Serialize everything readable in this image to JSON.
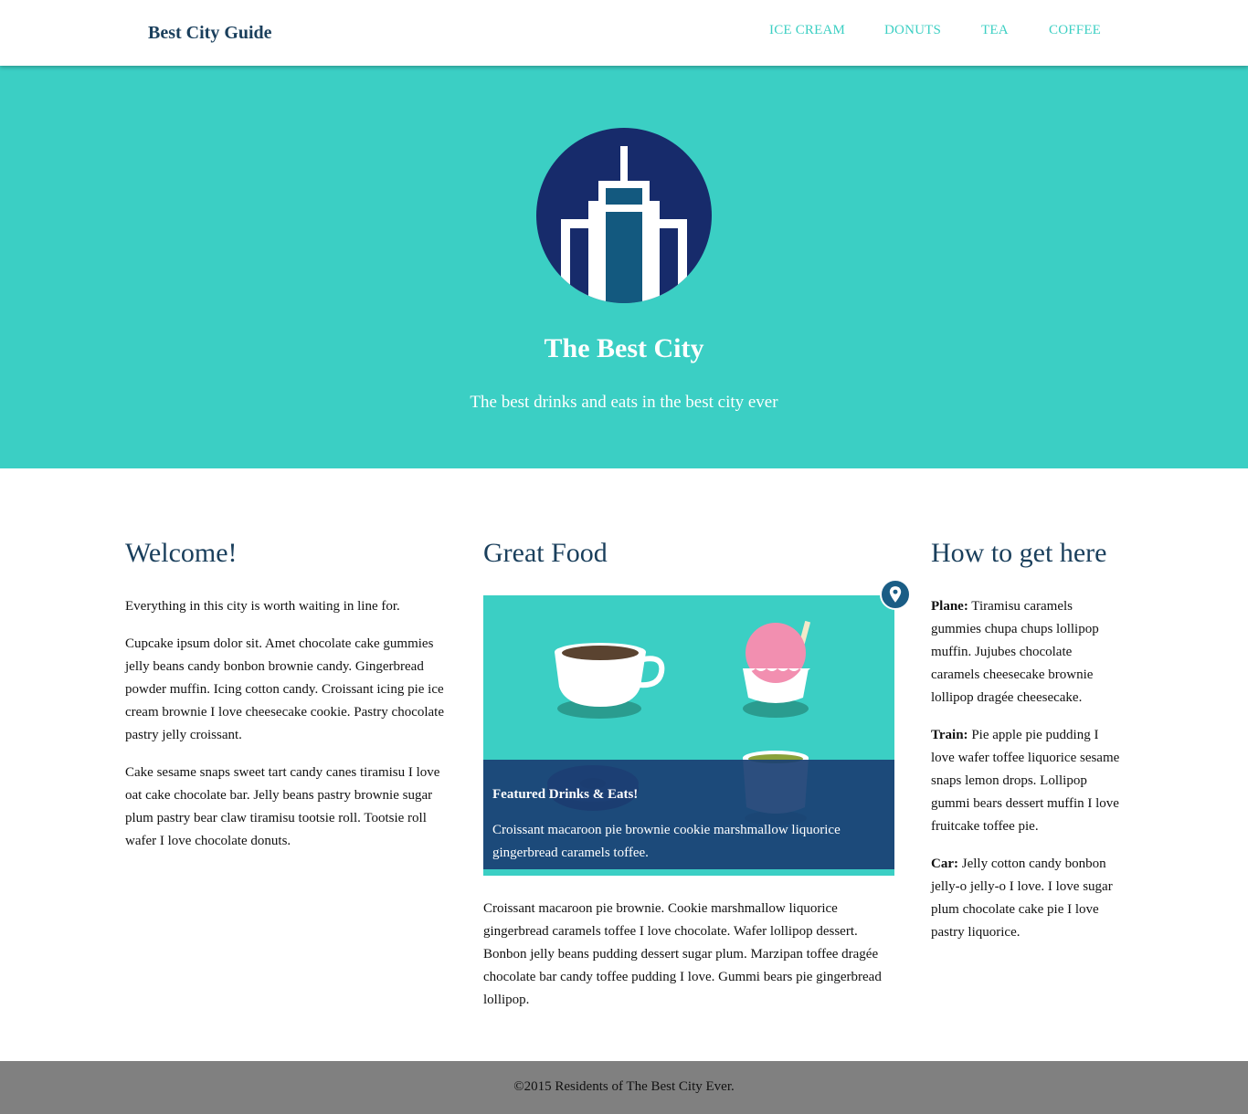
{
  "header": {
    "brand": "Best City Guide",
    "nav": [
      "ICE CREAM",
      "DONUTS",
      "TEA",
      "COFFEE"
    ]
  },
  "hero": {
    "title": "The Best City",
    "subtitle": "The best drinks and eats in the best city ever",
    "logo_icon": "city-tower-icon"
  },
  "welcome": {
    "heading": "Welcome!",
    "paragraphs": [
      "Everything in this city is worth waiting in line for.",
      "Cupcake ipsum dolor sit. Amet chocolate cake gummies jelly beans candy bonbon brownie candy. Gingerbread powder muffin. Icing cotton candy. Croissant icing pie ice cream brownie I love cheesecake cookie. Pastry chocolate pastry jelly croissant.",
      "Cake sesame snaps sweet tart candy canes tiramisu I love oat cake chocolate bar. Jelly beans pastry brownie sugar plum pastry bear claw tiramisu tootsie roll. Tootsie roll wafer I love chocolate donuts."
    ]
  },
  "food": {
    "heading": "Great Food",
    "caption_title": "Featured Drinks & Eats!",
    "caption_text": "Croissant macaroon pie brownie cookie marshmallow liquorice gingerbread caramels toffee.",
    "body": "Croissant macaroon pie brownie. Cookie marshmallow liquorice gingerbread caramels toffee I love chocolate. Wafer lollipop dessert. Bonbon jelly beans pudding dessert sugar plum. Marzipan toffee dragée chocolate bar candy toffee pudding I love. Gummi bears pie gingerbread lollipop."
  },
  "travel": {
    "heading": "How to get here",
    "items": [
      {
        "label": "Plane:",
        "text": " Tiramisu caramels gummies chupa chups lollipop muffin. Jujubes chocolate caramels cheesecake brownie lollipop dragée cheesecake."
      },
      {
        "label": "Train:",
        "text": " Pie apple pie pudding I love wafer toffee liquorice sesame snaps lemon drops. Lollipop gummi bears dessert muffin I love fruitcake toffee pie."
      },
      {
        "label": "Car:",
        "text": " Jelly cotton candy bonbon jelly-o jelly-o I love. I love sugar plum chocolate cake pie I love pastry liquorice."
      }
    ]
  },
  "footer": {
    "text": "©2015 Residents of The Best City Ever."
  },
  "colors": {
    "teal": "#3bcfc4",
    "navy": "#1a3f5c",
    "caption_bg": "#1a3f73",
    "footer_bg": "#808080"
  }
}
